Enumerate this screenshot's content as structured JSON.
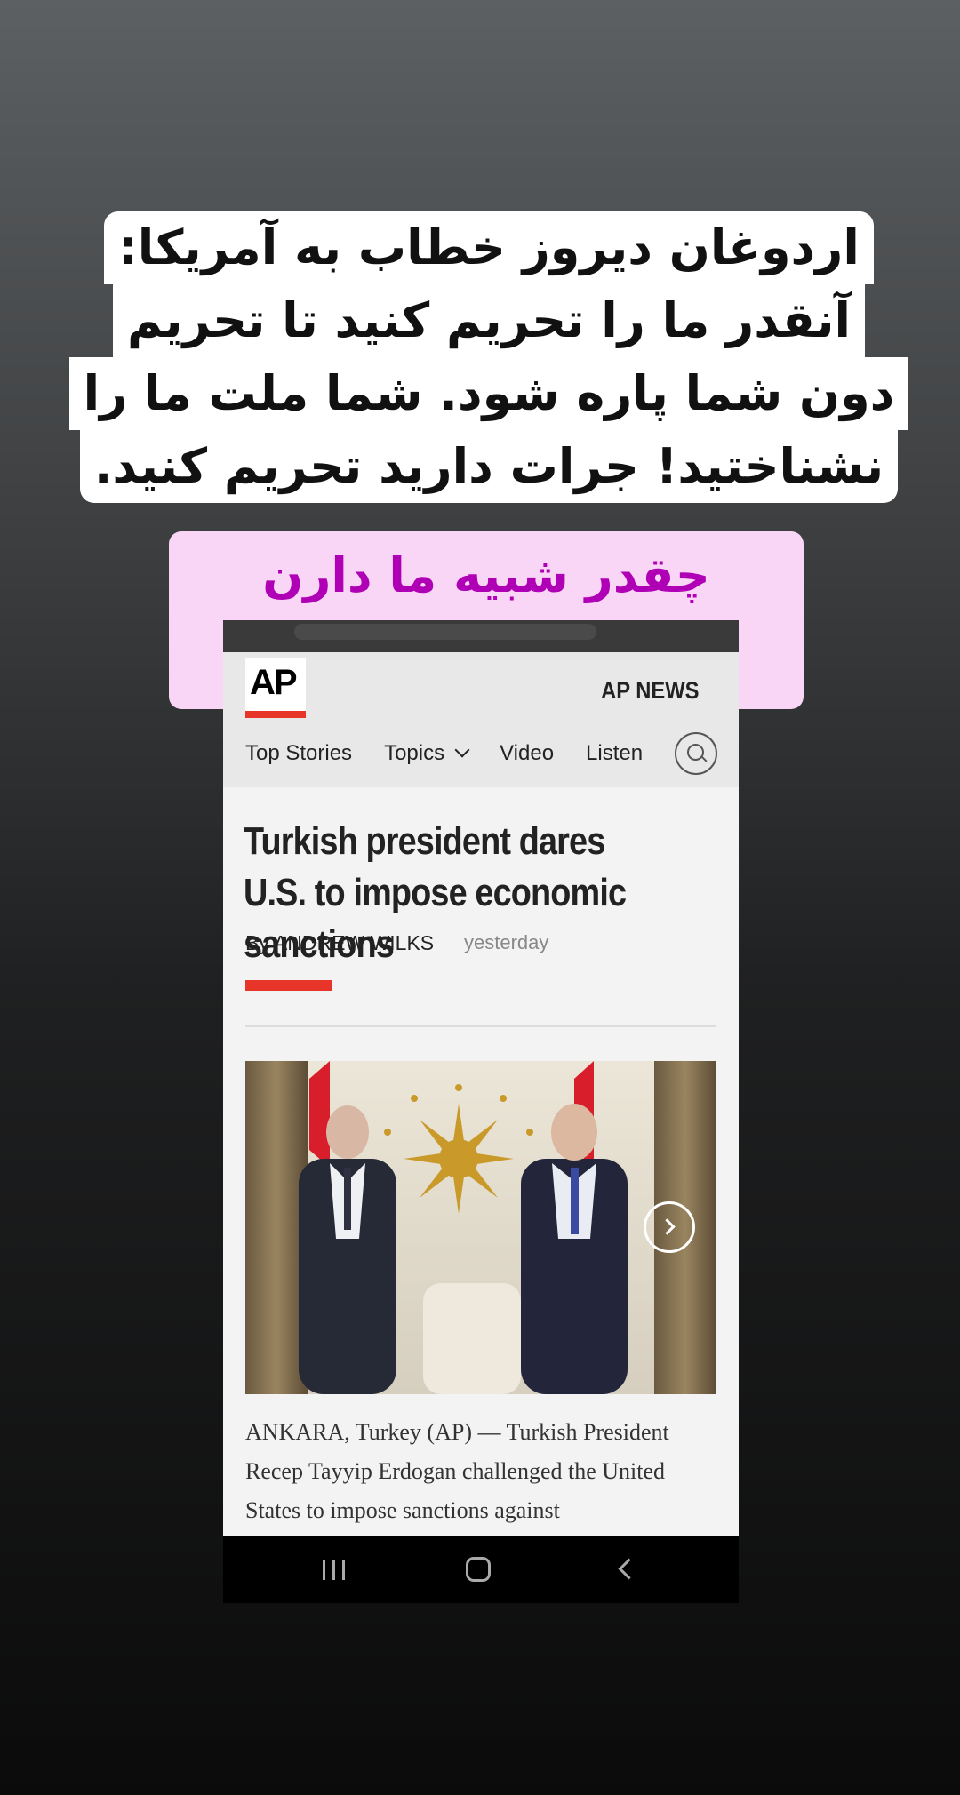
{
  "caption": {
    "lines": [
      "اردوغان دیروز خطاب به آمریکا:",
      "آنقدر ما را تحریم کنید تا تحریم",
      "دون شما پاره شود. شما ملت ما را",
      "نشناختید! جرات دارید تحریم کنید."
    ],
    "comment": "چقدر شبیه ما دارن میشن",
    "comment_color": "#b000b6",
    "comment_bg": "#f9d6f6"
  },
  "site": {
    "logo": "AP",
    "brand": "AP NEWS",
    "accent": "#e8352a",
    "nav": [
      "Top Stories",
      "Topics",
      "Video",
      "Listen"
    ]
  },
  "article": {
    "headline": "Turkish president dares U.S. to impose economic sanctions",
    "byline": "By ANDREW WILKS",
    "date": "yesterday",
    "body": "ANKARA, Turkey (AP) — Turkish President Recep Tayyip Erdogan challenged the United States to impose sanctions against"
  },
  "icons": {
    "search": "search-icon",
    "topics": "chevron-down-icon",
    "gallery_next": "chevron-right-icon",
    "system": [
      "recent-apps-icon",
      "home-icon",
      "back-icon"
    ]
  }
}
